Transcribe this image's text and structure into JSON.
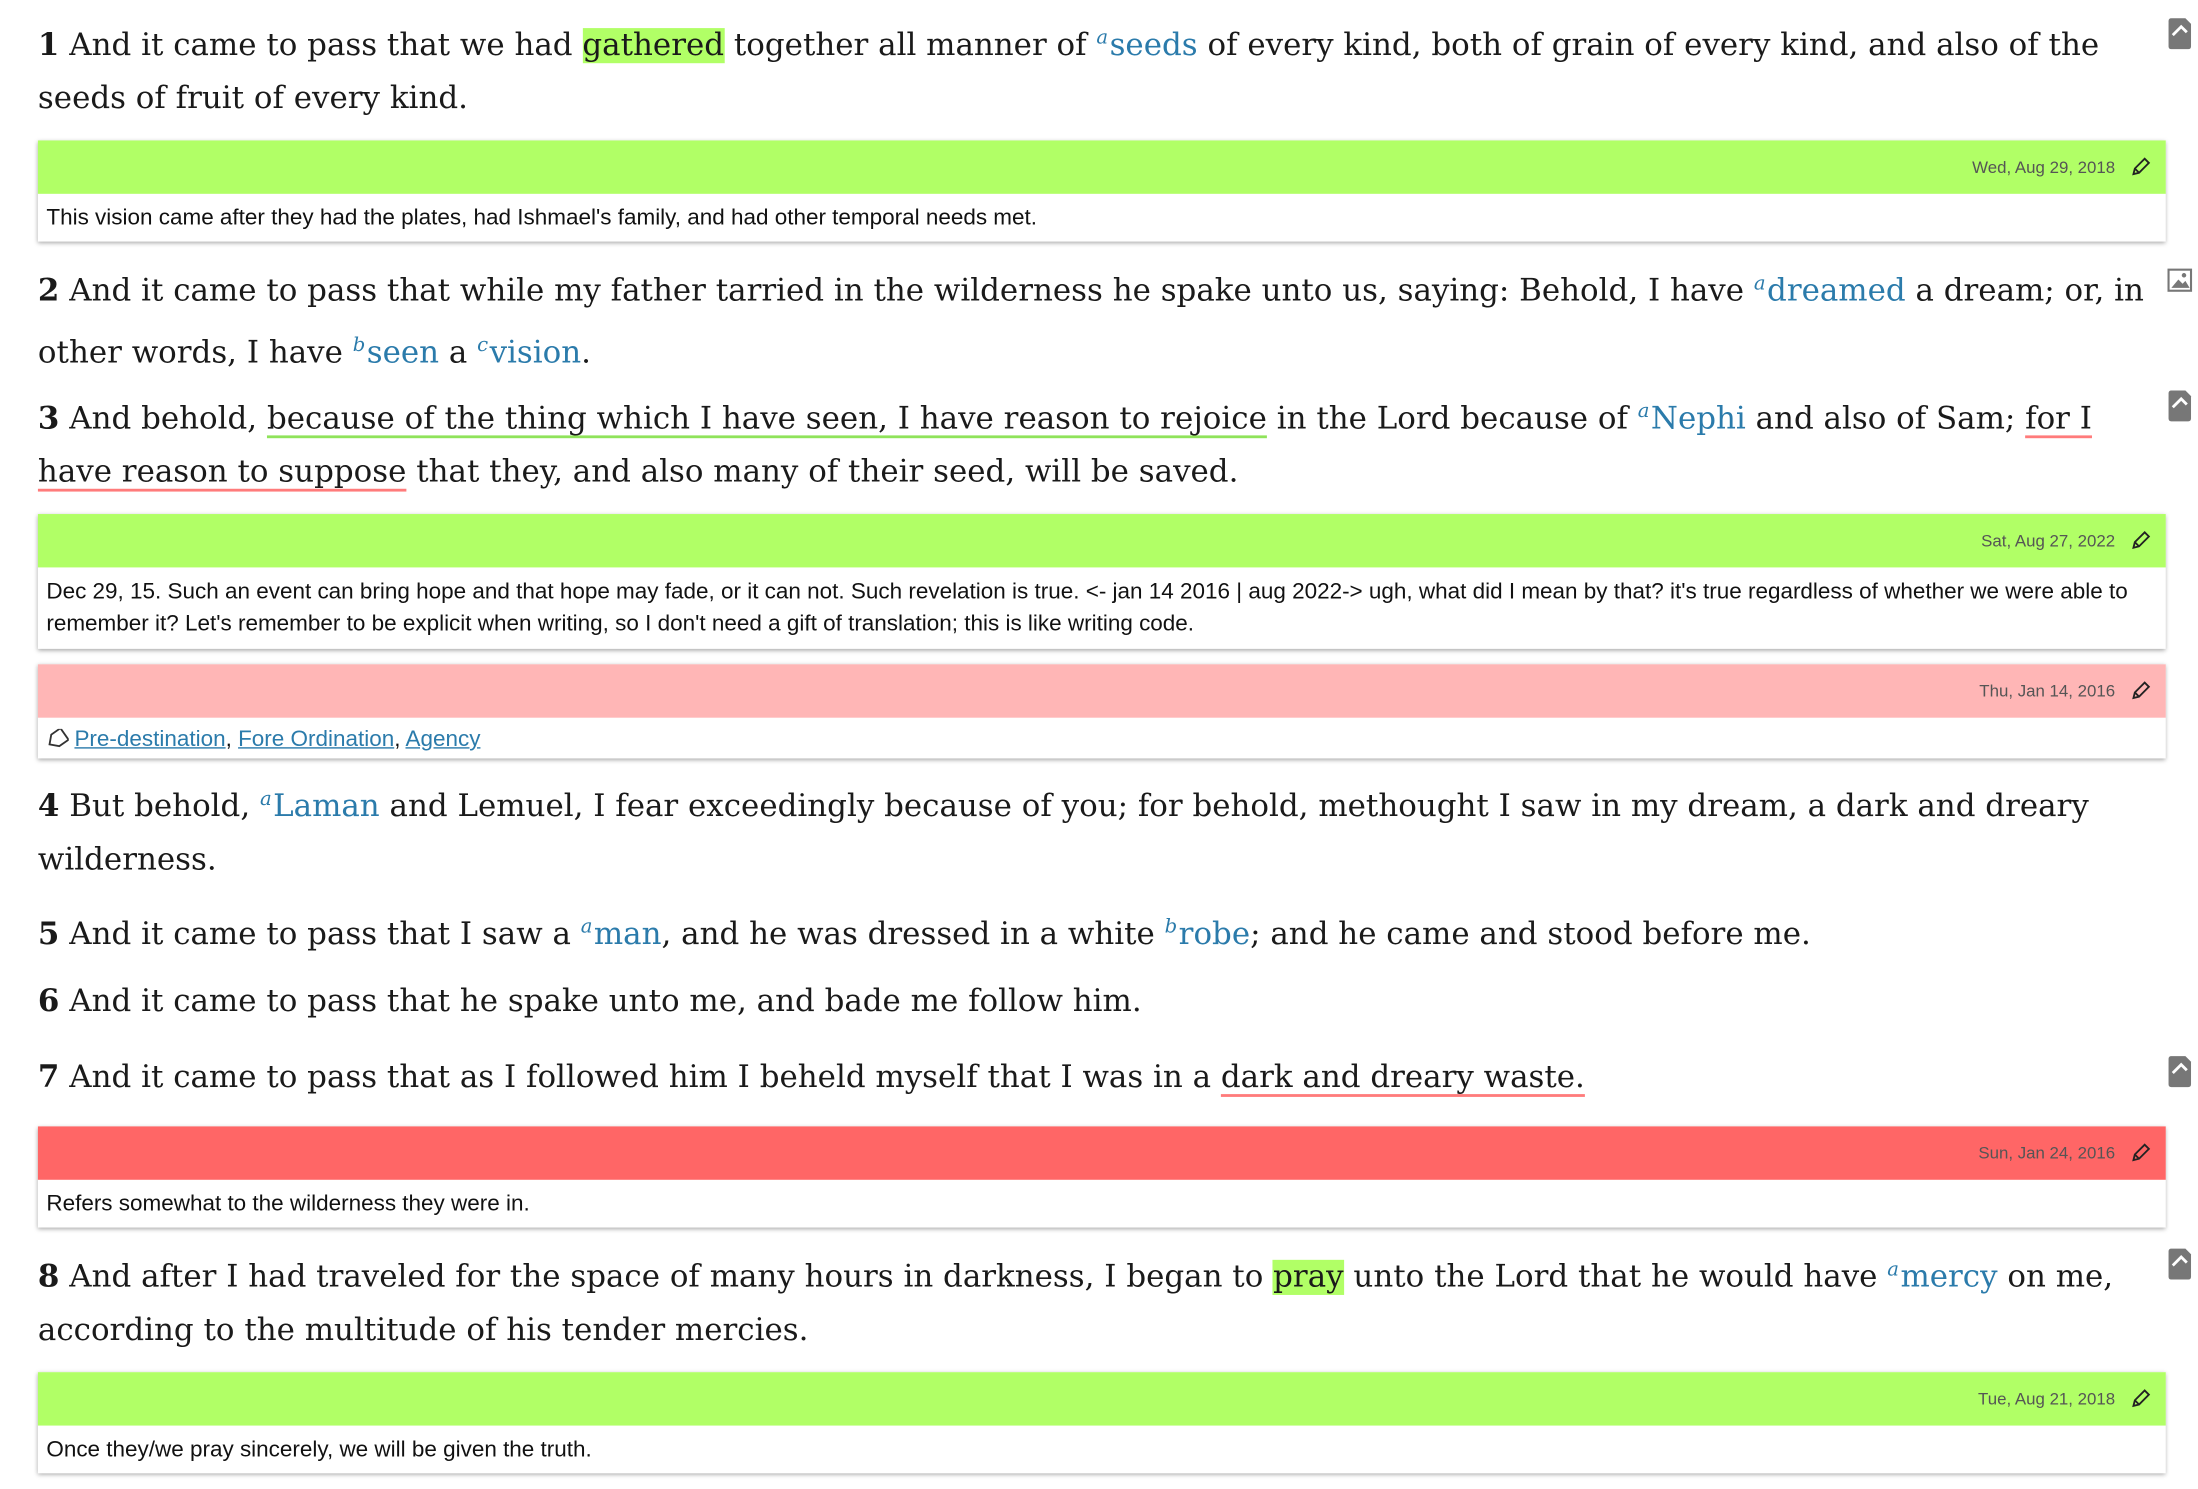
{
  "colors": {
    "note_green": "#b1ff66",
    "note_pink": "#ffb6b6",
    "note_red": "#ff6666",
    "link_blue": "#2b7bab"
  },
  "verses": [
    {
      "num": "1",
      "p1": "And it came to pass that we had ",
      "hl": "gathered",
      "p2": " together all manner of ",
      "fn1_sup": "a",
      "fn1": "seeds",
      "p3": " of every kind, both of grain of every kind, and also of the seeds of fruit of every kind."
    },
    {
      "num": "2",
      "p1": "And it came to pass that while my father tarried in the wilderness he spake unto us, saying: Behold, I have ",
      "fn1_sup": "a",
      "fn1": "dreamed",
      "p2": " a dream; or, in other words, I have ",
      "fn2_sup": "b",
      "fn2": "seen",
      "p3": " a ",
      "fn3_sup": "c",
      "fn3": "vision",
      "p4": "."
    },
    {
      "num": "3",
      "p1": "And behold, ",
      "ul1": "because of the thing which I have seen, I have reason to rejoice",
      "p2": " in the Lord because of ",
      "fn1_sup": "a",
      "fn1": "Nephi",
      "p3": " and also of Sam; ",
      "ul2": "for I have reason to suppose",
      "p4": " that they, and also many of their seed, will be saved."
    },
    {
      "num": "4",
      "p1": "But behold, ",
      "fn1_sup": "a",
      "fn1": "Laman",
      "p2": " and Lemuel, I fear exceedingly because of you; for behold, methought I saw in my dream, a dark and dreary wilderness."
    },
    {
      "num": "5",
      "p1": "And it came to pass that I saw a ",
      "fn1_sup": "a",
      "fn1": "man",
      "p2": ", and he was dressed in a white ",
      "fn2_sup": "b",
      "fn2": "robe",
      "p3": "; and he came and stood before me."
    },
    {
      "num": "6",
      "p1": "And it came to pass that he spake unto me, and bade me follow him."
    },
    {
      "num": "7",
      "p1": "And it came to pass that as I followed him I beheld myself that I was in a ",
      "ul1": "dark and dreary waste.",
      "p2": ""
    },
    {
      "num": "8",
      "p1": "And after I had traveled for the space of many hours in darkness, I began to ",
      "hl": "pray",
      "p2": " unto the Lord that he would have ",
      "fn1_sup": "a",
      "fn1": "mercy",
      "p3": " on me, according to the multitude of his tender mercies."
    }
  ],
  "notes": [
    {
      "date": "Wed, Aug 29, 2018",
      "text": "This vision came after they had the plates, had Ishmael's family, and had other temporal needs met."
    },
    {
      "date": "Sat, Aug 27, 2022",
      "text": "Dec 29, 15. Such an event can bring hope and that hope may fade, or it can not. Such revelation is true. <- jan 14 2016 | aug 2022-> ugh, what did I mean by that? it's true regardless of whether we were able to remember it? Let's remember to be explicit when writing, so I don't need a gift of translation; this is like writing code."
    },
    {
      "date": "Thu, Jan 14, 2016",
      "tags": [
        "Pre-destination",
        "Fore Ordination",
        "Agency"
      ],
      "sep": ", "
    },
    {
      "date": "Sun, Jan 24, 2016",
      "text": "Refers somewhat to the wilderness they were in."
    },
    {
      "date": "Tue, Aug 21, 2018",
      "text": "Once they/we pray sincerely, we will be given the truth."
    }
  ],
  "icons": {
    "note_side": "note-icon",
    "image_side": "image-icon",
    "edit": "pencil-icon",
    "tag": "tag-icon"
  }
}
